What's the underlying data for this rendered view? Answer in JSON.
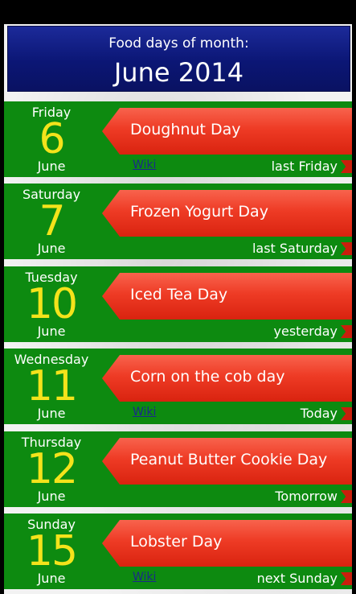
{
  "header": {
    "subtitle": "Food days of month:",
    "title": "June 2014"
  },
  "colors": {
    "header_bg": "#0b1675",
    "card_bg": "#0d8a10",
    "ribbon": "#ee3b25",
    "day_number": "#f4e31b"
  },
  "days": [
    {
      "weekday": "Friday",
      "number": "6",
      "month": "June",
      "food": "Doughnut Day",
      "relative": "last Friday",
      "wiki": "Wiki"
    },
    {
      "weekday": "Saturday",
      "number": "7",
      "month": "June",
      "food": "Frozen Yogurt Day",
      "relative": "last Saturday",
      "wiki": ""
    },
    {
      "weekday": "Tuesday",
      "number": "10",
      "month": "June",
      "food": "Iced Tea Day",
      "relative": "yesterday",
      "wiki": ""
    },
    {
      "weekday": "Wednesday",
      "number": "11",
      "month": "June",
      "food": "Corn on the cob day",
      "relative": "Today",
      "wiki": "Wiki"
    },
    {
      "weekday": "Thursday",
      "number": "12",
      "month": "June",
      "food": "Peanut Butter Cookie Day",
      "relative": "Tomorrow",
      "wiki": ""
    },
    {
      "weekday": "Sunday",
      "number": "15",
      "month": "June",
      "food": "Lobster Day",
      "relative": "next Sunday",
      "wiki": "Wiki"
    }
  ]
}
